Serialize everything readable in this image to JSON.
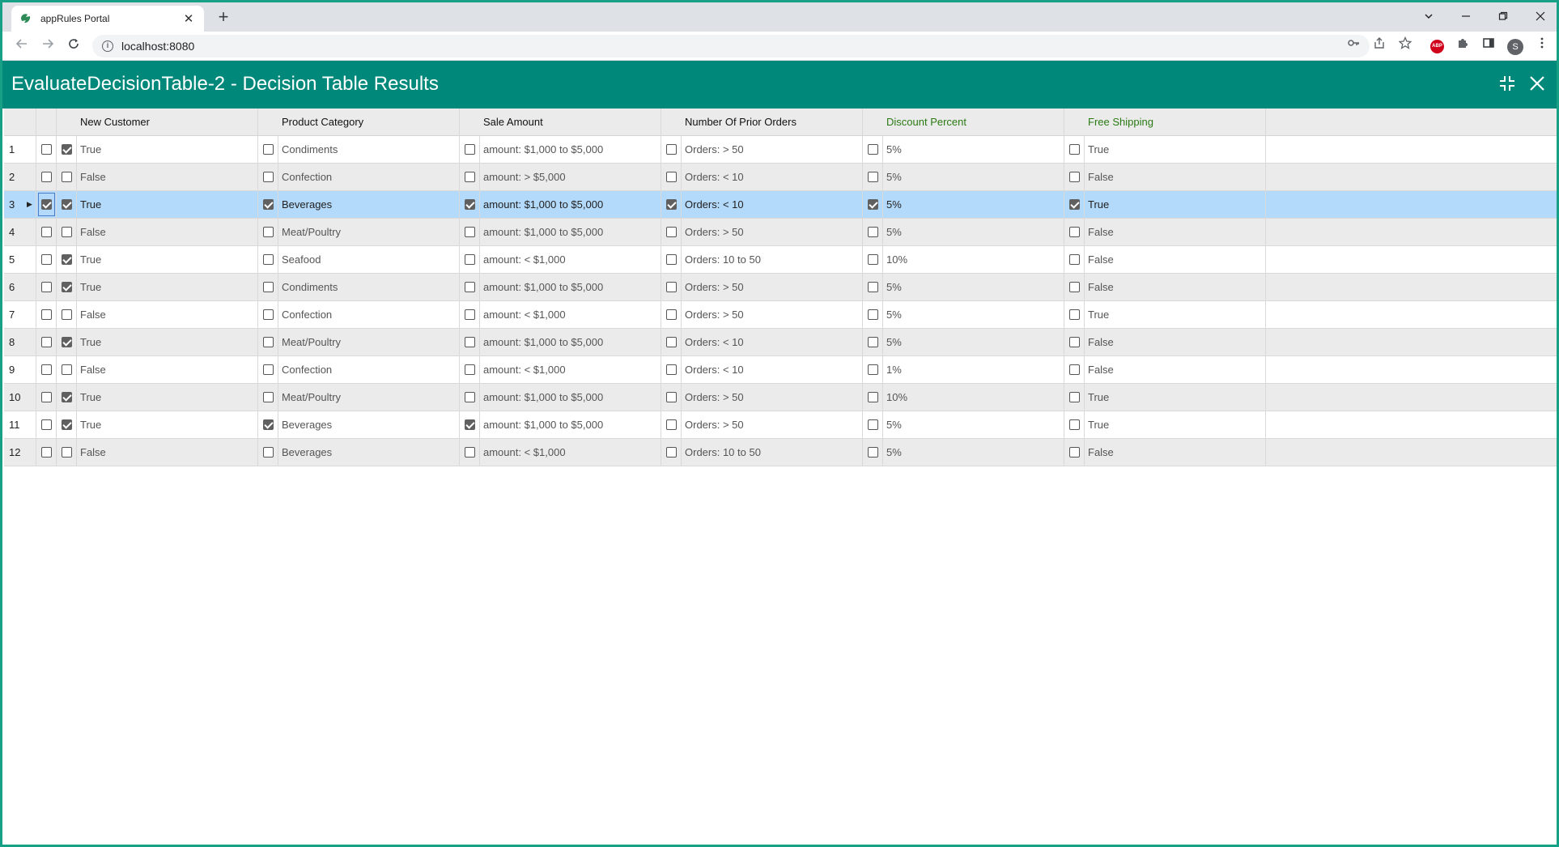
{
  "browser": {
    "tab_title": "appRules Portal",
    "tab_close": "✕",
    "new_tab": "+",
    "url": "localhost:8080",
    "avatar_letter": "S",
    "abp_label": "ABP"
  },
  "app": {
    "title": "EvaluateDecisionTable-2 - Decision Table Results"
  },
  "colors": {
    "header_bg": "#00897b",
    "output_header": "#2a7a14",
    "selected_row": "#b3d9fb"
  },
  "columns": [
    {
      "label": "New Customer",
      "output": false
    },
    {
      "label": "Product Category",
      "output": false
    },
    {
      "label": "Sale Amount",
      "output": false
    },
    {
      "label": "Number Of Prior Orders",
      "output": false
    },
    {
      "label": "Discount Percent",
      "output": true
    },
    {
      "label": "Free Shipping",
      "output": true
    }
  ],
  "rows": [
    {
      "num": "1",
      "sel": false,
      "cells": [
        {
          "c": true,
          "v": "True"
        },
        {
          "c": false,
          "v": "Condiments"
        },
        {
          "c": false,
          "v": "amount: $1,000 to $5,000"
        },
        {
          "c": false,
          "v": "Orders: > 50"
        },
        {
          "c": false,
          "v": "5%"
        },
        {
          "c": false,
          "v": "True"
        }
      ]
    },
    {
      "num": "2",
      "sel": false,
      "cells": [
        {
          "c": false,
          "v": "False"
        },
        {
          "c": false,
          "v": "Confection"
        },
        {
          "c": false,
          "v": "amount: > $5,000"
        },
        {
          "c": false,
          "v": "Orders: < 10"
        },
        {
          "c": false,
          "v": "5%"
        },
        {
          "c": false,
          "v": "False"
        }
      ]
    },
    {
      "num": "3",
      "sel": true,
      "cells": [
        {
          "c": true,
          "v": "True"
        },
        {
          "c": true,
          "v": "Beverages"
        },
        {
          "c": true,
          "v": "amount: $1,000 to $5,000"
        },
        {
          "c": true,
          "v": "Orders: < 10"
        },
        {
          "c": true,
          "v": "5%"
        },
        {
          "c": true,
          "v": "True"
        }
      ]
    },
    {
      "num": "4",
      "sel": false,
      "cells": [
        {
          "c": false,
          "v": "False"
        },
        {
          "c": false,
          "v": "Meat/Poultry"
        },
        {
          "c": false,
          "v": "amount: $1,000 to $5,000"
        },
        {
          "c": false,
          "v": "Orders: > 50"
        },
        {
          "c": false,
          "v": "5%"
        },
        {
          "c": false,
          "v": "False"
        }
      ]
    },
    {
      "num": "5",
      "sel": false,
      "cells": [
        {
          "c": true,
          "v": "True"
        },
        {
          "c": false,
          "v": "Seafood"
        },
        {
          "c": false,
          "v": "amount: < $1,000"
        },
        {
          "c": false,
          "v": "Orders: 10 to 50"
        },
        {
          "c": false,
          "v": "10%"
        },
        {
          "c": false,
          "v": "False"
        }
      ]
    },
    {
      "num": "6",
      "sel": false,
      "cells": [
        {
          "c": true,
          "v": "True"
        },
        {
          "c": false,
          "v": "Condiments"
        },
        {
          "c": false,
          "v": "amount: $1,000 to $5,000"
        },
        {
          "c": false,
          "v": "Orders: > 50"
        },
        {
          "c": false,
          "v": "5%"
        },
        {
          "c": false,
          "v": "False"
        }
      ]
    },
    {
      "num": "7",
      "sel": false,
      "cells": [
        {
          "c": false,
          "v": "False"
        },
        {
          "c": false,
          "v": "Confection"
        },
        {
          "c": false,
          "v": "amount: < $1,000"
        },
        {
          "c": false,
          "v": "Orders: > 50"
        },
        {
          "c": false,
          "v": "5%"
        },
        {
          "c": false,
          "v": "True"
        }
      ]
    },
    {
      "num": "8",
      "sel": false,
      "cells": [
        {
          "c": true,
          "v": "True"
        },
        {
          "c": false,
          "v": "Meat/Poultry"
        },
        {
          "c": false,
          "v": "amount: $1,000 to $5,000"
        },
        {
          "c": false,
          "v": "Orders: < 10"
        },
        {
          "c": false,
          "v": "5%"
        },
        {
          "c": false,
          "v": "False"
        }
      ]
    },
    {
      "num": "9",
      "sel": false,
      "cells": [
        {
          "c": false,
          "v": "False"
        },
        {
          "c": false,
          "v": "Confection"
        },
        {
          "c": false,
          "v": "amount: < $1,000"
        },
        {
          "c": false,
          "v": "Orders: < 10"
        },
        {
          "c": false,
          "v": "1%"
        },
        {
          "c": false,
          "v": "False"
        }
      ]
    },
    {
      "num": "10",
      "sel": false,
      "cells": [
        {
          "c": true,
          "v": "True"
        },
        {
          "c": false,
          "v": "Meat/Poultry"
        },
        {
          "c": false,
          "v": "amount: $1,000 to $5,000"
        },
        {
          "c": false,
          "v": "Orders: > 50"
        },
        {
          "c": false,
          "v": "10%"
        },
        {
          "c": false,
          "v": "True"
        }
      ]
    },
    {
      "num": "11",
      "sel": false,
      "cells": [
        {
          "c": true,
          "v": "True"
        },
        {
          "c": true,
          "v": "Beverages"
        },
        {
          "c": true,
          "v": "amount: $1,000 to $5,000"
        },
        {
          "c": false,
          "v": "Orders: > 50"
        },
        {
          "c": false,
          "v": "5%"
        },
        {
          "c": false,
          "v": "True"
        }
      ]
    },
    {
      "num": "12",
      "sel": false,
      "cells": [
        {
          "c": false,
          "v": "False"
        },
        {
          "c": false,
          "v": "Beverages"
        },
        {
          "c": false,
          "v": "amount: < $1,000"
        },
        {
          "c": false,
          "v": "Orders: 10 to 50"
        },
        {
          "c": false,
          "v": "5%"
        },
        {
          "c": false,
          "v": "False"
        }
      ]
    }
  ]
}
